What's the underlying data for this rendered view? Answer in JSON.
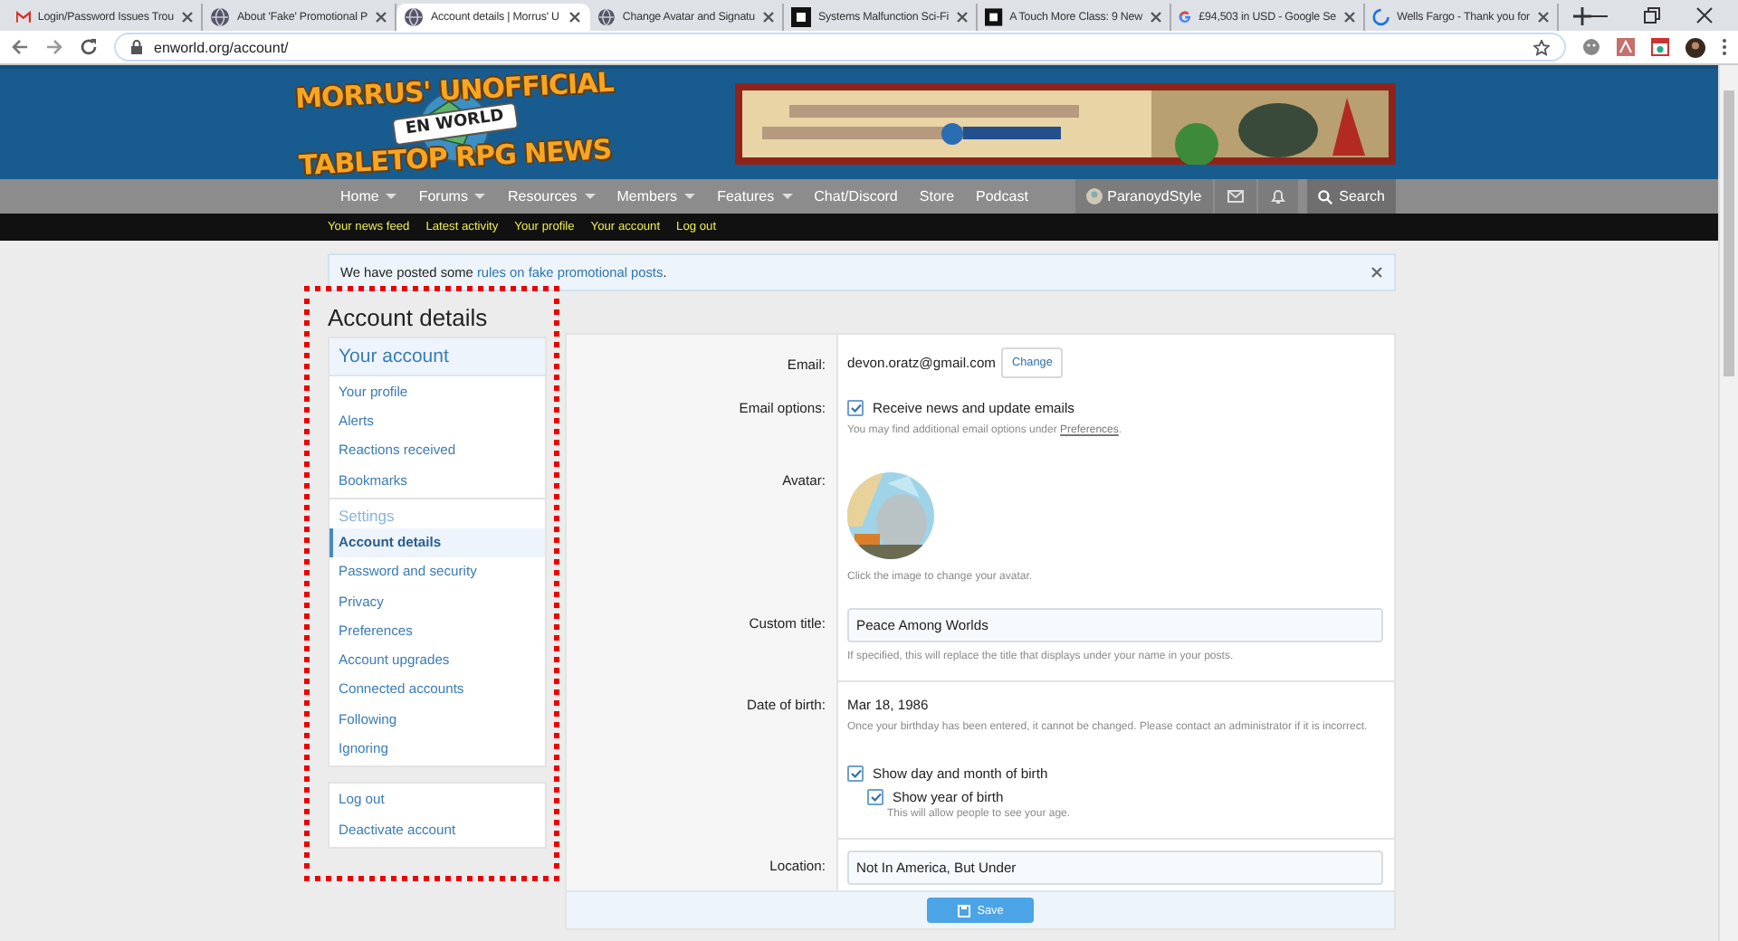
{
  "browser": {
    "tabs": [
      {
        "title": "Login/Password Issues Trou",
        "selected": false
      },
      {
        "title": "About 'Fake' Promotional P",
        "selected": false
      },
      {
        "title": "Account details | Morrus' U",
        "selected": true
      },
      {
        "title": "Change Avatar and Signatu",
        "selected": false
      },
      {
        "title": "Systems Malfunction Sci-Fi",
        "selected": false
      },
      {
        "title": "A Touch More Class: 9 New",
        "selected": false
      },
      {
        "title": "£94,503 in USD - Google Se",
        "selected": false
      },
      {
        "title": "Wells Fargo - Thank you for",
        "selected": false
      }
    ],
    "address": "enworld.org/account/"
  },
  "header": {
    "logo": {
      "top": "MORRUS' UNOFFICIAL",
      "badge": "EN WORLD",
      "bottom": "TABLETOP RPG NEWS"
    },
    "banner": {
      "kind": "picture"
    },
    "nav": [
      {
        "label": "Home",
        "dropdown": true
      },
      {
        "label": "Forums",
        "dropdown": true
      },
      {
        "label": "Resources",
        "dropdown": true
      },
      {
        "label": "Members",
        "dropdown": true
      },
      {
        "label": "Features",
        "dropdown": true
      },
      {
        "label": "Chat/Discord",
        "dropdown": false
      },
      {
        "label": "Store",
        "dropdown": false
      },
      {
        "label": "Podcast",
        "dropdown": false
      }
    ],
    "user": "ParanoydStyle",
    "search": "Search",
    "subnav": [
      "Your news feed",
      "Latest activity",
      "Your profile",
      "Your account",
      "Log out"
    ]
  },
  "notice": {
    "before": "We have posted some ",
    "link": "rules on fake promotional posts",
    "after": "."
  },
  "page_title": "Account details",
  "sidebar": {
    "highlighted": true,
    "panels": [
      {
        "sections": [
          {
            "heading": "Your account",
            "kind": "main",
            "items": [
              {
                "label": "Your profile",
                "selected": false
              },
              {
                "label": "Alerts",
                "selected": false
              },
              {
                "label": "Reactions received",
                "selected": false
              },
              {
                "label": "Bookmarks",
                "selected": false
              }
            ]
          },
          {
            "heading": "Settings",
            "kind": "sub",
            "items": [
              {
                "label": "Account details",
                "selected": true
              },
              {
                "label": "Password and security",
                "selected": false
              },
              {
                "label": "Privacy",
                "selected": false
              },
              {
                "label": "Preferences",
                "selected": false
              },
              {
                "label": "Account upgrades",
                "selected": false
              },
              {
                "label": "Connected accounts",
                "selected": false
              },
              {
                "label": "Following",
                "selected": false
              },
              {
                "label": "Ignoring",
                "selected": false
              }
            ]
          }
        ]
      },
      {
        "sections": [
          {
            "items": [
              {
                "label": "Log out",
                "selected": false
              },
              {
                "label": "Deactivate account",
                "selected": false
              }
            ]
          }
        ]
      }
    ]
  },
  "form": {
    "rows": [
      {
        "kind": "email",
        "label": "Email:",
        "value": "devon.oratz@gmail.com",
        "button": "Change"
      },
      {
        "kind": "options",
        "label": "Email options:",
        "checks": [
          {
            "label": "Receive news and update emails",
            "checked": true
          }
        ],
        "hint_before": "You may find additional email options under ",
        "hint_link": "Preferences",
        "hint_after": "."
      },
      {
        "kind": "avatar",
        "label": "Avatar:",
        "hint": "Click the image to change your avatar."
      },
      {
        "kind": "input",
        "label": "Custom title:",
        "value": "Peace Among Worlds",
        "hint": "If specified, this will replace the title that displays under your name in your posts.",
        "divider": true
      },
      {
        "kind": "date",
        "label": "Date of birth:",
        "value": "Mar 18, 1986",
        "hint": "Once your birthday has been entered, it cannot be changed. Please contact an administrator if it is incorrect.",
        "checks": [
          {
            "label": "Show day and month of birth",
            "checked": true,
            "children": [
              {
                "label": "Show year of birth",
                "checked": true,
                "hint": "This will allow people to see your age."
              }
            ]
          }
        ],
        "divider": true
      },
      {
        "kind": "input",
        "label": "Location:",
        "value": "Not In America, But Under"
      }
    ],
    "save": "Save"
  }
}
